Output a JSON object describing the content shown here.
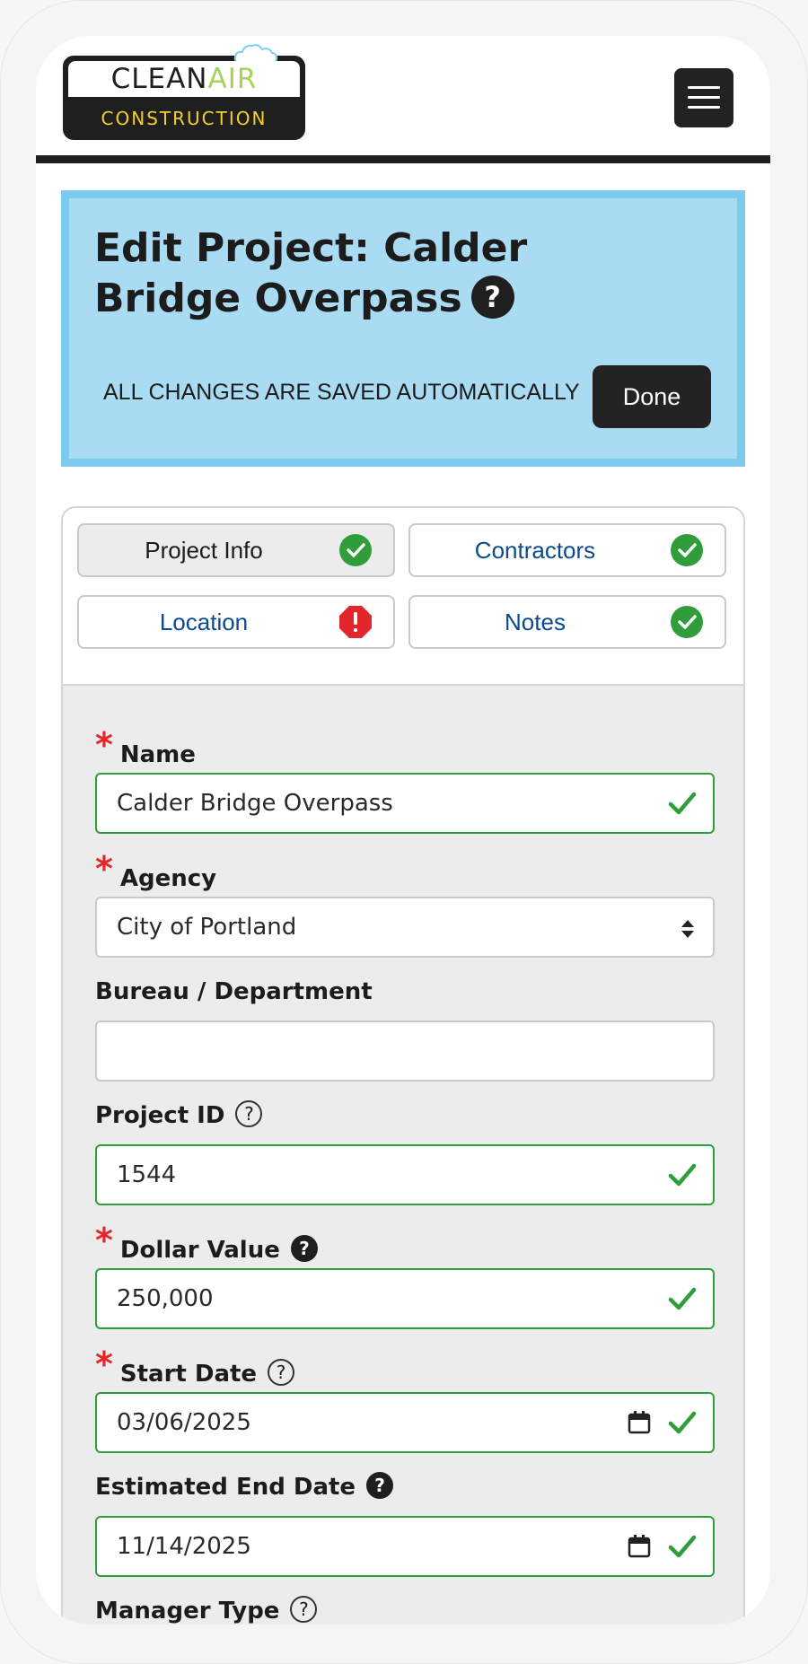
{
  "header": {
    "logo_clean": "CLEAN",
    "logo_air": "AIR",
    "logo_sub": "CONSTRUCTION"
  },
  "banner": {
    "title": "Edit Project: Calder Bridge Overpass",
    "autosave_text": "ALL CHANGES ARE SAVED AUTOMATICALLY",
    "done_label": "Done"
  },
  "tabs": [
    {
      "label": "Project Info",
      "status": "complete",
      "active": true
    },
    {
      "label": "Contractors",
      "status": "complete",
      "active": false
    },
    {
      "label": "Location",
      "status": "error",
      "active": false
    },
    {
      "label": "Notes",
      "status": "complete",
      "active": false
    }
  ],
  "form": {
    "name": {
      "label": "Name",
      "value": "Calder Bridge Overpass",
      "required": true,
      "valid": true
    },
    "agency": {
      "label": "Agency",
      "value": "City of Portland",
      "required": true
    },
    "bureau": {
      "label": "Bureau / Department",
      "value": ""
    },
    "project_id": {
      "label": "Project ID",
      "value": "1544",
      "valid": true
    },
    "dollar_value": {
      "label": "Dollar Value",
      "value": "250,000",
      "required": true,
      "valid": true
    },
    "start_date": {
      "label": "Start Date",
      "value": "03/06/2025",
      "required": true,
      "valid": true
    },
    "end_date": {
      "label": "Estimated End Date",
      "value": "11/14/2025",
      "valid": true
    },
    "manager_type": {
      "label": "Manager Type"
    }
  },
  "colors": {
    "banner_bg": "#a9dcf3",
    "banner_border": "#7ccaee",
    "valid_green": "#2f9e3a",
    "error_red": "#e3262b",
    "link_blue": "#0b4a8c"
  }
}
